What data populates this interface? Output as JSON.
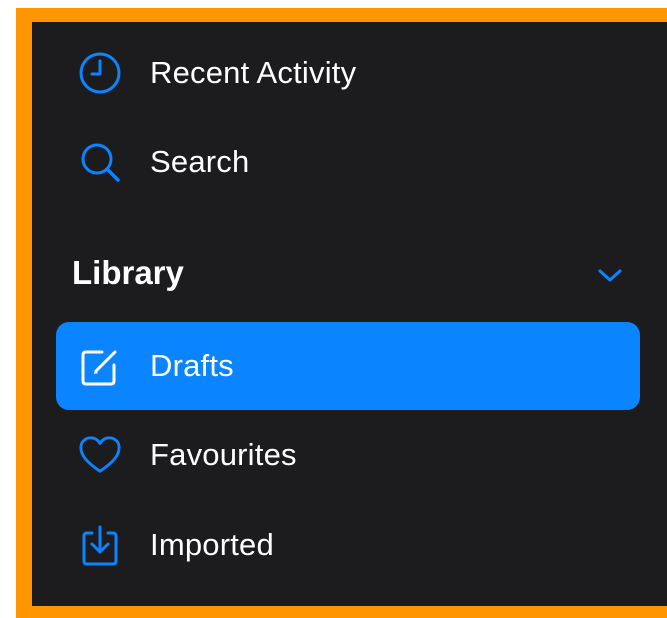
{
  "colors": {
    "accent": "#0A84FF",
    "background": "#1C1C1E",
    "border": "#FF9500",
    "text": "#FFFFFF"
  },
  "nav": {
    "items": [
      {
        "label": "Recent Activity",
        "icon": "clock-icon"
      },
      {
        "label": "Search",
        "icon": "magnifier-icon"
      }
    ]
  },
  "library": {
    "title": "Library",
    "expanded": true,
    "toggle_icon": "chevron-down-icon",
    "items": [
      {
        "label": "Drafts",
        "icon": "compose-icon",
        "selected": true
      },
      {
        "label": "Favourites",
        "icon": "heart-icon",
        "selected": false
      },
      {
        "label": "Imported",
        "icon": "import-tray-icon",
        "selected": false
      }
    ]
  }
}
